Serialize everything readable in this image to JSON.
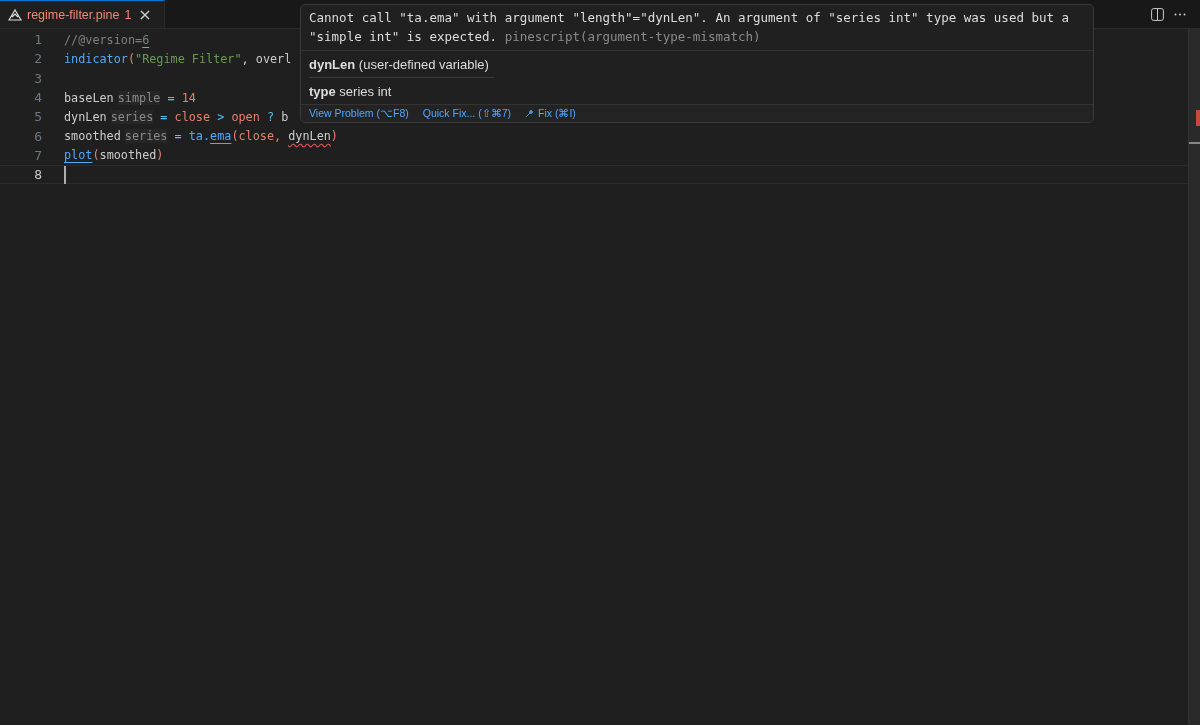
{
  "tab": {
    "title": "regime-filter.pine",
    "problems": "1",
    "close": "×",
    "selected": true,
    "has_error": true
  },
  "editor": {
    "lines": [
      {
        "number": "1",
        "tokens": [
          {
            "text": "//@version=",
            "kind": "comment"
          },
          {
            "text": "6",
            "kind": "comment",
            "underlined": true
          }
        ]
      },
      {
        "number": "2",
        "tokens": [
          {
            "text": "indicator",
            "kind": "func"
          },
          {
            "text": "(",
            "kind": "paren"
          },
          {
            "text": "\"Regime Filter\"",
            "kind": "string"
          },
          {
            "text": ", overl",
            "kind": "plain"
          }
        ]
      },
      {
        "number": "3"
      },
      {
        "number": "4",
        "tokens": [
          {
            "text": "baseLen",
            "kind": "plain"
          },
          {
            "text": "simple",
            "kind": "hint"
          },
          {
            "text": " = ",
            "kind": "op"
          },
          {
            "text": "14",
            "kind": "number"
          }
        ]
      },
      {
        "number": "5",
        "tokens": [
          {
            "text": "dynLen",
            "kind": "plain"
          },
          {
            "text": "series",
            "kind": "hint"
          },
          {
            "text": " = ",
            "kind": "op"
          },
          {
            "text": "close",
            "kind": "builtin"
          },
          {
            "text": " > ",
            "kind": "op"
          },
          {
            "text": "open",
            "kind": "builtin"
          },
          {
            "text": " ? ",
            "kind": "op"
          },
          {
            "text": "b",
            "kind": "plain"
          }
        ]
      },
      {
        "number": "6",
        "tokens": [
          {
            "text": "smoothed",
            "kind": "plain"
          },
          {
            "text": "series",
            "kind": "hint"
          },
          {
            "text": " = ",
            "kind": "op"
          },
          {
            "text": "ta.",
            "kind": "func"
          },
          {
            "text": "ema",
            "kind": "func",
            "underlined": true
          },
          {
            "text": "(",
            "kind": "paren"
          },
          {
            "text": "close, ",
            "kind": "builtin"
          },
          {
            "text": "dynLen",
            "kind": "plain",
            "error": true
          },
          {
            "text": ")",
            "kind": "paren"
          }
        ]
      },
      {
        "number": "7",
        "tokens": [
          {
            "text": "plot",
            "kind": "func",
            "underlined": true
          },
          {
            "text": "(",
            "kind": "paren"
          },
          {
            "text": "smoothed",
            "kind": "plain"
          },
          {
            "text": ")",
            "kind": "paren"
          }
        ]
      },
      {
        "number": "8",
        "current": true
      }
    ]
  },
  "hover": {
    "message": "Cannot call \"ta.ema\" with argument \"length\"=\"dynLen\". An argument of \"series int\" type was used but a \"simple int\"  is expected.",
    "source": "pinescript(argument-type-mismatch)",
    "symbol": "**dynLen** (user-defined variable)",
    "type": "**type** series int",
    "actions": [
      {
        "label": "View Problem (⌥F8)",
        "kind": "plain"
      },
      {
        "label": "Quick Fix... (⇧⌘7)",
        "kind": "plain"
      },
      {
        "label": "Fix (⌘I)",
        "kind": "ai"
      }
    ]
  }
}
